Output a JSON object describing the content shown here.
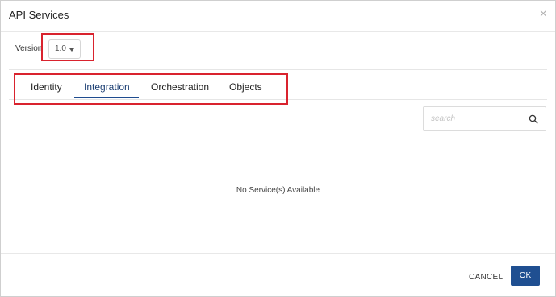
{
  "dialog": {
    "title": "API Services",
    "close_symbol": "×"
  },
  "version": {
    "label": "Version",
    "selected": "1.0"
  },
  "tabs": [
    {
      "label": "Identity"
    },
    {
      "label": "Integration",
      "active": true
    },
    {
      "label": "Orchestration"
    },
    {
      "label": "Objects"
    }
  ],
  "search": {
    "placeholder": "search",
    "icon": "search-icon"
  },
  "empty_message": "No Service(s) Available",
  "footer": {
    "cancel_label": "CANCEL",
    "ok_label": "OK"
  },
  "colors": {
    "accent": "#1f4f91",
    "annotation_red": "#d9232e"
  }
}
